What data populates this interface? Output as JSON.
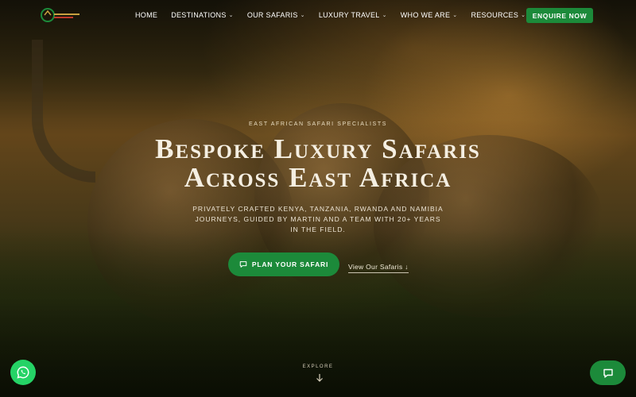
{
  "nav": {
    "items": [
      {
        "label": "HOME",
        "has_dropdown": false
      },
      {
        "label": "DESTINATIONS",
        "has_dropdown": true
      },
      {
        "label": "OUR SAFARIS",
        "has_dropdown": true
      },
      {
        "label": "LUXURY TRAVEL",
        "has_dropdown": true
      },
      {
        "label": "WHO WE ARE",
        "has_dropdown": true
      },
      {
        "label": "RESOURCES",
        "has_dropdown": true
      }
    ],
    "dropdown_glyph": "⌄",
    "cta_label": "ENQUIRE NOW"
  },
  "hero": {
    "eyebrow": "EAST AFRICAN SAFARI SPECIALISTS",
    "headline_line1": "Bespoke Luxury Safaris",
    "headline_line2": "Across East Africa",
    "subhead": "Privately crafted Kenya, Tanzania, Rwanda and Namibia journeys, guided by Martin and a team with 20+ years in the field.",
    "primary_button": "PLAN YOUR SAFARI",
    "primary_button_icon": "chat-bubble-icon",
    "secondary_link": "View Our Safaris ↓",
    "explore_label": "EXPLORE",
    "explore_icon": "arrow-down-icon"
  },
  "floating": {
    "left_icon": "whatsapp-icon",
    "right_icon": "chat-bubble-icon"
  },
  "colors": {
    "accent_green": "#1c8a3a",
    "whatsapp_green": "#25d366",
    "text_light": "#f5efe2"
  }
}
